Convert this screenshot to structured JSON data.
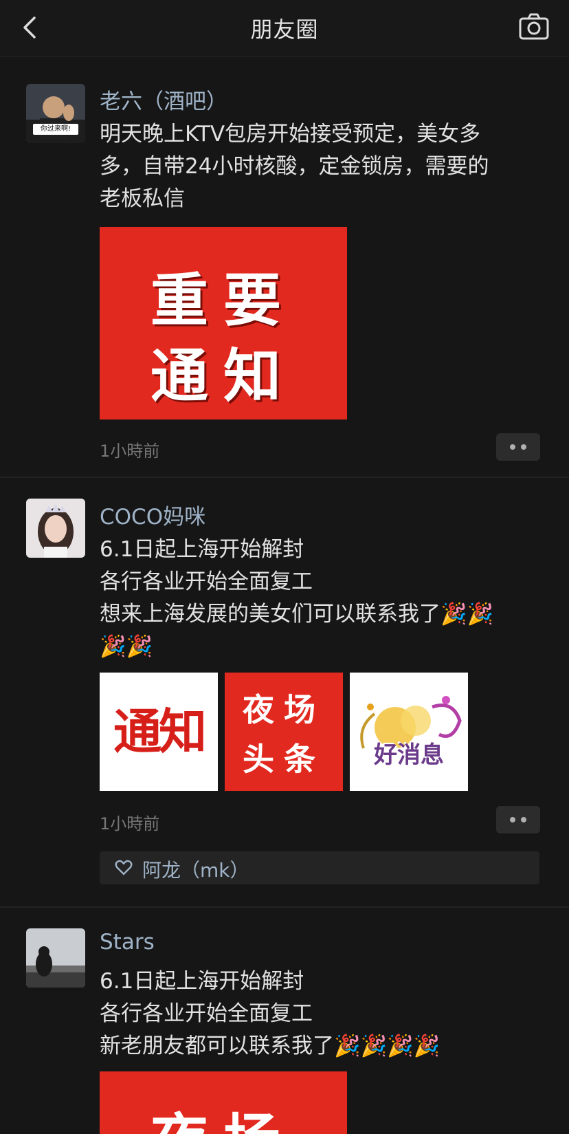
{
  "header": {
    "title": "朋友圈",
    "back_icon": "back-chevron-icon",
    "camera_icon": "camera-icon"
  },
  "posts": [
    {
      "name": "老六（酒吧）",
      "avatar_caption": "你过来啊!",
      "lines": [
        "明天晚上KTV包房开始接受预定，美女多",
        "多，自带24小时核酸，定金锁房，需要的",
        "老板私信"
      ],
      "images": [
        {
          "line1": "重要",
          "line2": "通知"
        }
      ],
      "time": "1小時前"
    },
    {
      "name": "COCO妈咪",
      "lines": [
        "6.1日起上海开始解封",
        "各行各业开始全面复工",
        "想来上海发展的美女们可以联系我了🎉🎉",
        "🎉🎉"
      ],
      "images": [
        {
          "text": "通知"
        },
        {
          "line1": "夜场",
          "line2": "头条"
        },
        {
          "text": "好消息"
        }
      ],
      "time": "1小時前",
      "likes": "阿龙（mk）"
    },
    {
      "name": "Stars",
      "lines": [
        "6.1日起上海开始解封",
        "各行各业开始全面复工",
        "新老朋友都可以联系我了🎉🎉🎉🎉"
      ],
      "images": [
        {
          "text": "夜场"
        }
      ]
    }
  ],
  "colors": {
    "background": "#161616",
    "name": "#9fb3c8",
    "red_image": "#e2291f"
  }
}
